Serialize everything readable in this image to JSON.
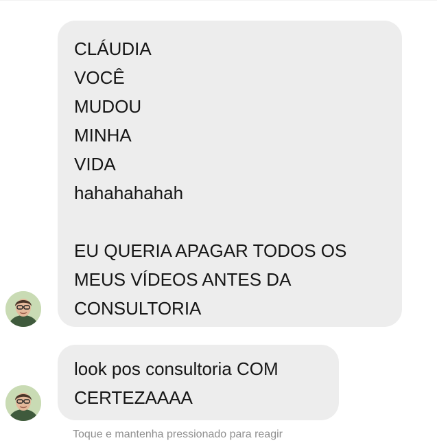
{
  "messages": [
    {
      "lines": [
        "CLÁUDIA",
        "VOCÊ",
        "MUDOU",
        "MINHA",
        "VIDA",
        "hahahahahah"
      ],
      "paragraph_2": [
        "EU QUERIA APAGAR TODOS OS",
        "MEUS VÍDEOS ANTES DA",
        "CONSULTORIA"
      ]
    },
    {
      "lines": [
        "look pos consultoria COM",
        "CERTEZAAAA"
      ]
    }
  ],
  "reaction_hint": "Toque e mantenha pressionado para reagir",
  "colors": {
    "bubble_background": "#ededed",
    "hint_text": "#8e8e8e",
    "avatar_background": "#cfe0bd"
  },
  "icons": {
    "sender_avatar": "avatar-icon"
  }
}
